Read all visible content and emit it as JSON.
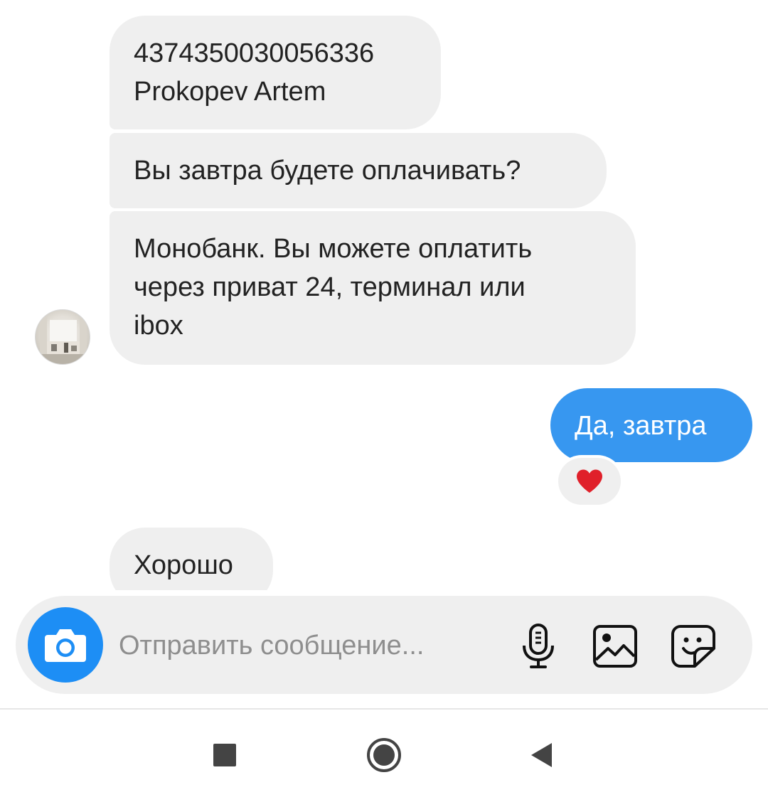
{
  "messages": [
    {
      "direction": "incoming",
      "text": "4374350030056336\nProkopev Artem"
    },
    {
      "direction": "incoming",
      "text": "Вы завтра будете оплачивать?"
    },
    {
      "direction": "incoming",
      "text": "Монобанк. Вы можете оплатить\nчерез приват 24, терминал или\nibox"
    },
    {
      "direction": "outgoing",
      "text": "Да, завтра",
      "reaction": "heart"
    },
    {
      "direction": "incoming",
      "text": "Хорошо"
    }
  ],
  "composer": {
    "placeholder": "Отправить сообщение...",
    "value": ""
  },
  "icons": {
    "camera": "camera-icon",
    "mic": "microphone-icon",
    "gallery": "image-gallery-icon",
    "sticker": "sticker-icon",
    "reaction": "heart-icon",
    "nav_recents": "square-recents-icon",
    "nav_home": "circle-home-icon",
    "nav_back": "triangle-back-icon"
  },
  "colors": {
    "incoming_bubble": "#efefef",
    "outgoing_bubble": "#3797f0",
    "camera_button": "#1d8ef5",
    "heart": "#e0202a",
    "placeholder": "#8e8e8e"
  }
}
